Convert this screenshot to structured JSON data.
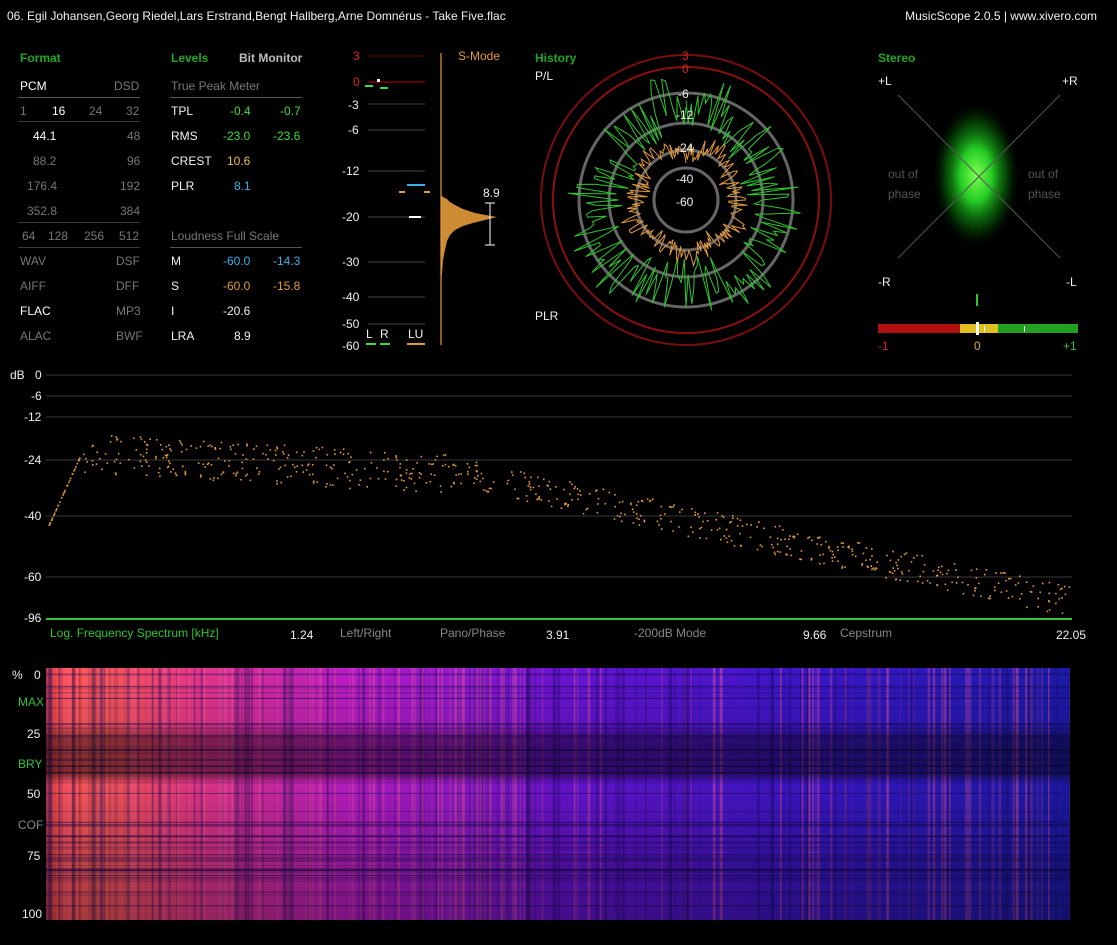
{
  "title": "06. Egil Johansen,Georg Riedel,Lars Erstrand,Bengt Hallberg,Arne Domnérus - Take Five.flac",
  "app": "MusicScope 2.0.5 | www.xivero.com",
  "format": {
    "heading": "Format",
    "pcm": "PCM",
    "dsd": "DSD",
    "bits": [
      "1",
      "16",
      "24",
      "32"
    ],
    "rates_left": [
      "44.1",
      "88.2",
      "176.4",
      "352.8"
    ],
    "rates_right": [
      "48",
      "96",
      "192",
      "384"
    ],
    "dsd_rates": [
      "64",
      "128",
      "256",
      "512"
    ],
    "formats_left": [
      "WAV",
      "AIFF",
      "FLAC",
      "ALAC"
    ],
    "formats_right": [
      "DSF",
      "DFF",
      "MP3",
      "BWF"
    ]
  },
  "levels": {
    "heading": "Levels",
    "bit_monitor": "Bit Monitor",
    "true_peak": "True Peak Meter",
    "rows": [
      {
        "label": "TPL",
        "a": "-0.4",
        "b": "-0.7"
      },
      {
        "label": "RMS",
        "a": "-23.0",
        "b": "-23.6"
      },
      {
        "label": "CREST",
        "a": "10.6"
      },
      {
        "label": "PLR",
        "a": "8.1"
      }
    ],
    "loudness": "Loudness Full Scale",
    "lrows": [
      {
        "label": "M",
        "a": "-60.0",
        "b": "-14.3"
      },
      {
        "label": "S",
        "a": "-60.0",
        "b": "-15.8"
      },
      {
        "label": "I",
        "a": "-20.6"
      },
      {
        "label": "LRA",
        "a": "8.9"
      }
    ]
  },
  "meter": {
    "smode": "S-Mode",
    "scale": [
      "3",
      "0",
      "-3",
      "-6",
      "-12",
      "-20",
      "-30",
      "-40",
      "-50",
      "-60"
    ],
    "plr_value": "8.9",
    "l": "L",
    "r": "R",
    "lu": "LU"
  },
  "history": {
    "heading": "History",
    "pl": "P/L",
    "plr": "PLR",
    "rings": [
      "3",
      "0",
      "-6",
      "-12",
      "-24",
      "-40",
      "-60"
    ]
  },
  "stereo": {
    "heading": "Stereo",
    "pl": "+L",
    "pr": "+R",
    "ml": "-R",
    "mr": "-L",
    "oop_left": "out of\nphase",
    "oop_right": "out of\nphase",
    "corr": [
      "-1",
      "0",
      "+1"
    ]
  },
  "spectrum": {
    "db": "dB",
    "yticks": [
      "0",
      "-6",
      "-12",
      "-24",
      "-40",
      "-60",
      "-96"
    ],
    "label": "Log. Frequency Spectrum [kHz]",
    "xticks": [
      "1.24",
      "3.91",
      "9.66",
      "22.05"
    ],
    "modes": [
      "Left/Right",
      "Pano/Phase",
      "-200dB Mode",
      "Cepstrum"
    ]
  },
  "spectrogram": {
    "labels": [
      "%",
      "0",
      "MAX",
      "25",
      "BRY",
      "50",
      "COF",
      "75",
      "100"
    ]
  },
  "colors": {
    "green": "#2ec42e",
    "orange": "#e39a3a",
    "red": "#8a1010",
    "blue": "#3ab0e8"
  }
}
